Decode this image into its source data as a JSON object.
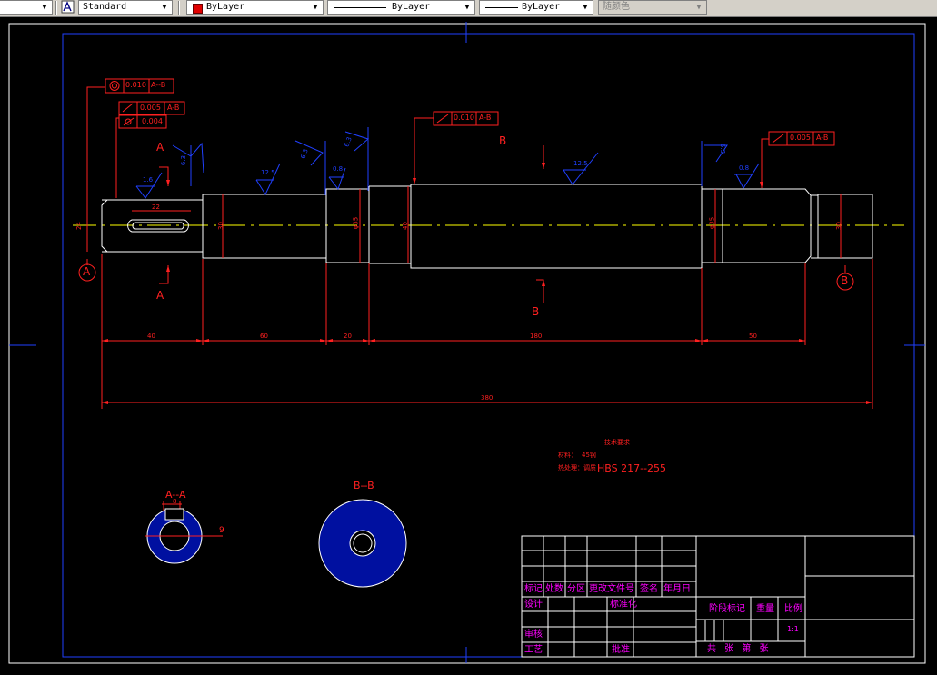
{
  "toolbar": {
    "left_arrow": "▼",
    "textstyle_value": "Standard",
    "color_value": "ByLayer",
    "linetype_value": "ByLayer",
    "lineweight_value": "ByLayer",
    "plotstyle_value": "随颜色",
    "dropdown_arrow": "▼"
  },
  "colors": {
    "background": "#000000",
    "red": "#ff2020",
    "blue": "#2040ff",
    "white": "#ffffff",
    "yellow": "#ffff00",
    "magenta": "#ff00ff"
  },
  "drawing": {
    "section_a_top": "A",
    "section_a_bottom": "A",
    "section_b_top": "B",
    "section_b_bottom": "B",
    "datum_a": "A",
    "datum_b": "B",
    "tolerances": {
      "concentricity_value": "0.010",
      "concentricity_ref": "A--B",
      "runout1_value": "0.005",
      "runout1_ref": "A-B",
      "cylindricity_value": "0.004",
      "runout2_value": "0.010",
      "runout2_ref": "A-B",
      "runout3_value": "0.005",
      "runout3_ref": "A-B"
    },
    "roughness": {
      "r1": "1.6",
      "r2": "12.5",
      "r3": "6.3",
      "r4": "0.8",
      "r5": "6.3",
      "r6": "12.5",
      "r7": "6.3",
      "r8": "0.8",
      "r9": "6.3"
    },
    "diameters": {
      "d1": "24",
      "d2": "30",
      "d3": "φ35",
      "d4": "40",
      "d5": "φ35",
      "d6": "30"
    },
    "keyway_length": "22",
    "dims": {
      "seg1": "40",
      "seg2": "60",
      "seg3": "20",
      "seg4": "180",
      "seg5": "50",
      "overall": "380"
    },
    "notes": {
      "heading": "技术要求",
      "material_label": "材料：",
      "material_value": "45钢",
      "heat_label": "热处理：调质",
      "heat_value": "HBS 217--255"
    },
    "section_aa": {
      "label": "A--A",
      "width": "8",
      "depth": "9"
    },
    "section_bb": {
      "label": "B--B"
    }
  },
  "title_block": {
    "biaoji": "标记",
    "chushu": "处数",
    "fenqu": "分区",
    "gengai": "更改文件号",
    "qianming": "签名",
    "nianyueri": "年月日",
    "sheji": "设计",
    "biaozhunhua": "标准化",
    "jieduanbiaoji": "阶段标记",
    "zhongliang": "重量",
    "bili": "比例",
    "scale_value": "1:1",
    "shenhe": "审核",
    "gongyi": "工艺",
    "pizhun": "批准",
    "sheets": "共 张 第 张"
  }
}
